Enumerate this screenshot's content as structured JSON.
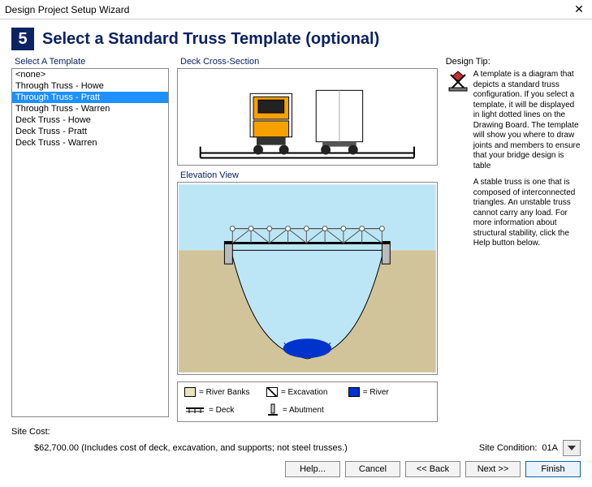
{
  "window": {
    "title": "Design Project Setup Wizard"
  },
  "step": {
    "number": "5",
    "title": "Select a Standard Truss Template (optional)"
  },
  "templateList": {
    "label": "Select A Template",
    "items": [
      "<none>",
      "Through Truss - Howe",
      "Through Truss - Pratt",
      "Through Truss - Warren",
      "Deck Truss - Howe",
      "Deck Truss - Pratt",
      "Deck Truss - Warren"
    ],
    "selectedIndex": 2
  },
  "deckSection": {
    "label": "Deck Cross-Section"
  },
  "elevation": {
    "label": "Elevation View"
  },
  "legend": {
    "banks": "= River Banks",
    "excavation": "= Excavation",
    "river": "= River",
    "deck": "= Deck",
    "abutment": "= Abutment"
  },
  "tip": {
    "label": "Design Tip:",
    "p1": "A template is a diagram that depicts a standard truss configuration. If you select a template, it will be displayed in light dotted lines on the Drawing Board. The template will show you where to draw joints and members to ensure that your bridge design is table",
    "p2": "A stable truss is one that is composed of interconnected triangles. An unstable truss cannot carry any load. For more information about structural stability, click the Help button below."
  },
  "siteCost": {
    "label": "Site Cost:",
    "value": "$62,700.00  (Includes cost of deck, excavation, and supports; not steel trusses.)"
  },
  "siteCondition": {
    "label": "Site Condition:",
    "value": "01A"
  },
  "buttons": {
    "help": "Help...",
    "cancel": "Cancel",
    "back": "<< Back",
    "next": "Next >>",
    "finish": "Finish"
  }
}
